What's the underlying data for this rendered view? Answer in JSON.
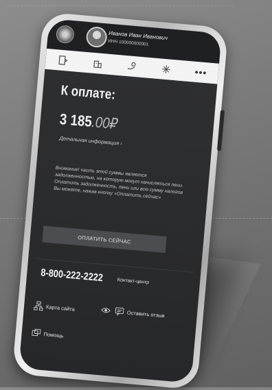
{
  "user": {
    "name": "Иванов Иван Иванович",
    "inn": "ИНН 100000000001"
  },
  "nav": {
    "more_label": "•••"
  },
  "payment": {
    "title": "К оплате:",
    "amount_int": "3 185",
    "amount_frac": ".00₽",
    "details_link": "Детальная информация  ›"
  },
  "warning": {
    "text": "Внимание! часть этой суммы является задолженностью, на которую могут начисляться пени. Оплатить задолженность, пени или всю сумму налогов Вы можете, нажав кнопку «Оплатить сейчас»"
  },
  "pay_button": {
    "label": "ОПЛАТИТЬ СЕЙЧАС"
  },
  "contact": {
    "phone": "8-800-222-2222",
    "label": "Контакт-центр"
  },
  "footer": {
    "sitemap": "Карта сайта",
    "feedback": "Оставить отзыв",
    "help": "Помощь"
  },
  "colors": {
    "screen_bg": "#2f3032",
    "navbar_bg": "#f3f3f3",
    "button_bg": "#4c4d50"
  }
}
